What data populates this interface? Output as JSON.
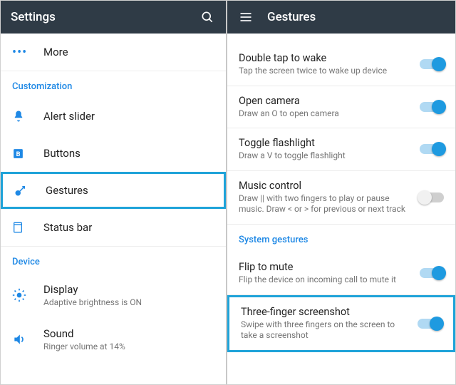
{
  "left": {
    "title": "Settings",
    "more_label": "More",
    "section_customization": "Customization",
    "items": {
      "alert_slider": "Alert slider",
      "buttons": "Buttons",
      "gestures": "Gestures",
      "status_bar": "Status bar"
    },
    "section_device": "Device",
    "display": {
      "label": "Display",
      "sub": "Adaptive brightness is ON"
    },
    "sound": {
      "label": "Sound",
      "sub": "Ringer volume at 14%"
    }
  },
  "right": {
    "title": "Gestures",
    "items": {
      "double_tap": {
        "label": "Double tap to wake",
        "sub": "Tap the screen twice to wake up device",
        "on": true
      },
      "open_camera": {
        "label": "Open camera",
        "sub": "Draw an O to open camera",
        "on": true
      },
      "flashlight": {
        "label": "Toggle flashlight",
        "sub": "Draw a V to toggle flashlight",
        "on": true
      },
      "music": {
        "label": "Music control",
        "sub": "Draw || with two fingers to play or pause music. Draw < or > for previous or next track",
        "on": false
      }
    },
    "section_system": "System gestures",
    "flip": {
      "label": "Flip to mute",
      "sub": "Flip the device on incoming call to mute it",
      "on": true
    },
    "screenshot": {
      "label": "Three-finger screenshot",
      "sub": "Swipe with three fingers on the screen to take a screenshot",
      "on": true
    }
  }
}
